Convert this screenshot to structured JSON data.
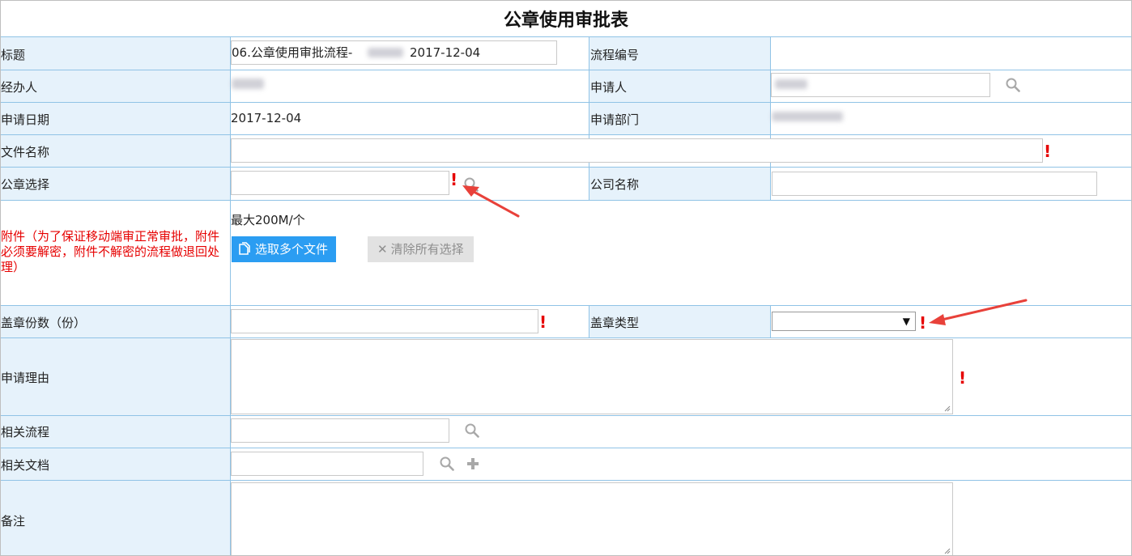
{
  "form": {
    "title": "公章使用审批表",
    "rows": {
      "title_row": {
        "label": "标题",
        "value": "06.公章使用审批流程-",
        "date": "2017-12-04",
        "label2": "流程编号"
      },
      "handler_row": {
        "label": "经办人",
        "label2": "申请人"
      },
      "date_row": {
        "label": "申请日期",
        "value": "2017-12-04",
        "label2": "申请部门"
      },
      "filename_row": {
        "label": "文件名称",
        "value": ""
      },
      "seal_row": {
        "label": "公章选择",
        "value": "",
        "label2": "公司名称",
        "value2": ""
      },
      "attach_row": {
        "label": "附件（为了保证移动端审正常审批，附件必须要解密，附件不解密的流程做退回处理）",
        "max_size": "最大200M/个",
        "select_button": "选取多个文件",
        "clear_button": "清除所有选择"
      },
      "copies_row": {
        "label": "盖章份数（份）",
        "value": "",
        "label2": "盖章类型",
        "select_value": ""
      },
      "reason_row": {
        "label": "申请理由",
        "value": ""
      },
      "related_flow_row": {
        "label": "相关流程",
        "value": ""
      },
      "related_doc_row": {
        "label": "相关文档",
        "value": ""
      },
      "remark_row": {
        "label": "备注",
        "value": ""
      }
    },
    "required_mark": "!"
  },
  "colors": {
    "label_bg": "#e6f2fb",
    "border": "#90c3e6",
    "required": "#e60000",
    "primary_button": "#2b9df2",
    "annotation_arrow": "#e8413a"
  },
  "icons": [
    "search-icon",
    "plus-icon",
    "file-icon",
    "close-icon",
    "dropdown-arrow-icon",
    "resize-grip-icon",
    "annotation-arrow"
  ]
}
